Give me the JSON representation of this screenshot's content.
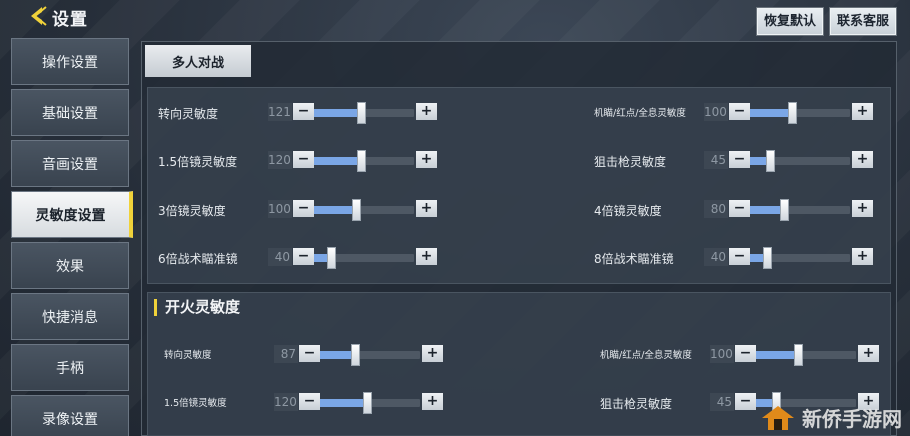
{
  "header": {
    "title": "设置",
    "reset_label": "恢复默认",
    "support_label": "联系客服"
  },
  "sidebar": {
    "items": [
      {
        "label": "操作设置"
      },
      {
        "label": "基础设置"
      },
      {
        "label": "音画设置"
      },
      {
        "label": "灵敏度设置",
        "active": true
      },
      {
        "label": "效果"
      },
      {
        "label": "快捷消息"
      },
      {
        "label": "手柄"
      },
      {
        "label": "录像设置"
      }
    ]
  },
  "tab": {
    "label": "多人对战"
  },
  "section_camera": {
    "left": [
      {
        "label": "转向灵敏度",
        "value": "121",
        "level": 0.47
      },
      {
        "label": "1.5倍镜灵敏度",
        "value": "120",
        "level": 0.47
      },
      {
        "label": "3倍镜灵敏度",
        "value": "100",
        "level": 0.42
      },
      {
        "label": "6倍战术瞄准镜",
        "value": "40",
        "level": 0.17
      }
    ],
    "right": [
      {
        "label": "机瞄/红点/全息灵敏度",
        "value": "100",
        "level": 0.42
      },
      {
        "label": "狙击枪灵敏度",
        "value": "45",
        "level": 0.2
      },
      {
        "label": "4倍镜灵敏度",
        "value": "80",
        "level": 0.34
      },
      {
        "label": "8倍战术瞄准镜",
        "value": "40",
        "level": 0.17
      }
    ]
  },
  "section_fire": {
    "title": "开火灵敏度",
    "left": [
      {
        "label": "转向灵敏度",
        "value": "87",
        "level": 0.35
      },
      {
        "label": "1.5倍镜灵敏度",
        "value": "120",
        "level": 0.47
      }
    ],
    "right": [
      {
        "label": "机瞄/红点/全息灵敏度",
        "value": "100",
        "level": 0.42
      },
      {
        "label": "狙击枪灵敏度",
        "value": "45",
        "level": 0.2
      }
    ]
  },
  "controls": {
    "minus": "−",
    "plus": "+"
  },
  "watermark": {
    "text": "新侨手游网"
  }
}
